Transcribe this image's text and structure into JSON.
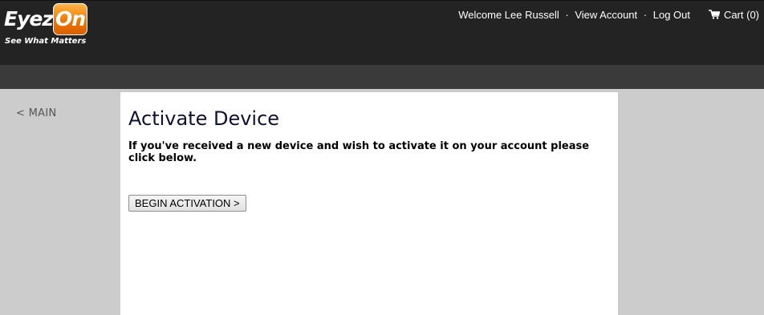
{
  "header": {
    "logo": {
      "word_left": "Eyez",
      "word_right": "On",
      "tagline": "See What Matters"
    },
    "nav": {
      "welcome": "Welcome Lee Russell",
      "separator": "·",
      "view_account": "View Account",
      "log_out": "Log Out"
    },
    "cart": {
      "icon": "shopping-cart-icon",
      "label": "Cart (0)"
    }
  },
  "sidebar": {
    "back_link": "< MAIN"
  },
  "main": {
    "title": "Activate Device",
    "description": "If you've received a new device and wish to activate it on your account please click below.",
    "button_label": "BEGIN ACTIVATION >"
  },
  "colors": {
    "header_bg": "#232323",
    "subbar_bg": "#3a3a3a",
    "page_bg": "#cccccc",
    "logo_orange": "#f07800",
    "title_color": "#0f1133"
  }
}
